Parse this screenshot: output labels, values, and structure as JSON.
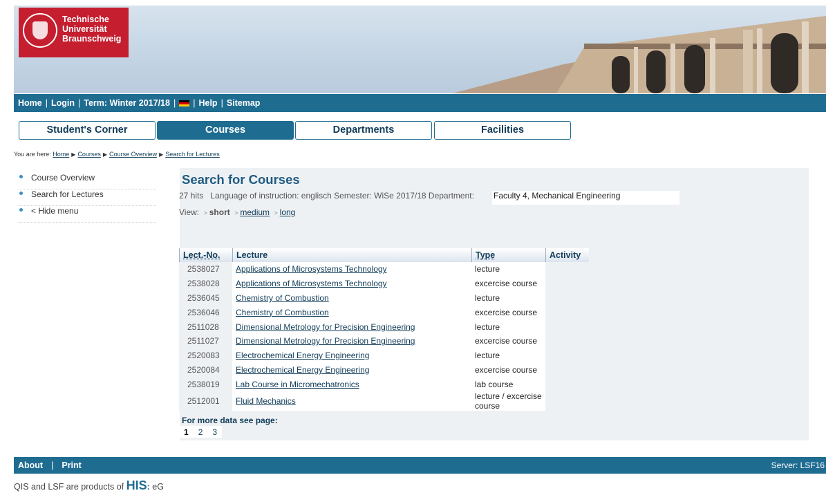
{
  "header": {
    "logo_line1": "Technische",
    "logo_line2": "Universität",
    "logo_line3": "Braunschweig"
  },
  "topnav": {
    "home": "Home",
    "login": "Login",
    "term": "Term: Winter 2017/18",
    "help": "Help",
    "sitemap": "Sitemap",
    "sep": "|"
  },
  "tabs": {
    "students_corner": "Student's Corner",
    "courses": "Courses",
    "departments": "Departments",
    "facilities": "Facilities"
  },
  "breadcrumb": {
    "prefix": "You are here:",
    "home": "Home",
    "courses": "Courses",
    "course_overview": "Course Overview",
    "search": "Search for Lectures"
  },
  "leftmenu": {
    "course_overview": "Course Overview",
    "search_for_lectures": "Search for Lectures",
    "hide_menu": "< Hide menu"
  },
  "main": {
    "title": "Search for Courses",
    "hits": "27 hits",
    "filter_text": "Language of instruction: englisch Semester: WiSe 2017/18 Department:",
    "department": "Faculty  4, Mechanical Engineering",
    "view_label": "View:",
    "view_short": "short",
    "view_medium": "medium",
    "view_long": "long",
    "more_data": "For more data see page:"
  },
  "table": {
    "headers": {
      "number": "Lect.-No.",
      "lecture": "Lecture",
      "type": "Type",
      "activity": "Activity"
    },
    "rows": [
      {
        "no": "2538027",
        "lecture": "Applications of Microsystems Technology",
        "type": "lecture"
      },
      {
        "no": "2538028",
        "lecture": "Applications of Microsystems Technology",
        "type": "excercise course"
      },
      {
        "no": "2536045",
        "lecture": "Chemistry of Combustion",
        "type": "lecture"
      },
      {
        "no": "2536046",
        "lecture": "Chemistry of Combustion",
        "type": "excercise course"
      },
      {
        "no": "2511028",
        "lecture": "Dimensional Metrology for Precision Engineering",
        "type": "lecture"
      },
      {
        "no": "2511027",
        "lecture": "Dimensional Metrology for Precision Engineering",
        "type": "excercise course"
      },
      {
        "no": "2520083",
        "lecture": "Electrochemical Energy Engineering",
        "type": "lecture"
      },
      {
        "no": "2520084",
        "lecture": "Electrochemical Energy Engineering",
        "type": "excercise course"
      },
      {
        "no": "2538019",
        "lecture": "Lab Course in Micromechatronics",
        "type": "lab course"
      },
      {
        "no": "2512001",
        "lecture": "Fluid Mechanics",
        "type": "lecture / excercise course"
      }
    ]
  },
  "pager": {
    "pages": [
      "1",
      "2",
      "3"
    ],
    "current": "1"
  },
  "footer": {
    "about": "About",
    "sep": "|",
    "print": "Print",
    "server": "Server: LSF16"
  },
  "credits": {
    "text": "QIS and LSF are products of",
    "his": "HIS",
    "eg": "eG"
  },
  "colors": {
    "nav_blue": "#1f6c91",
    "tub_red": "#c41e2f",
    "title_blue": "#1f5b82"
  }
}
